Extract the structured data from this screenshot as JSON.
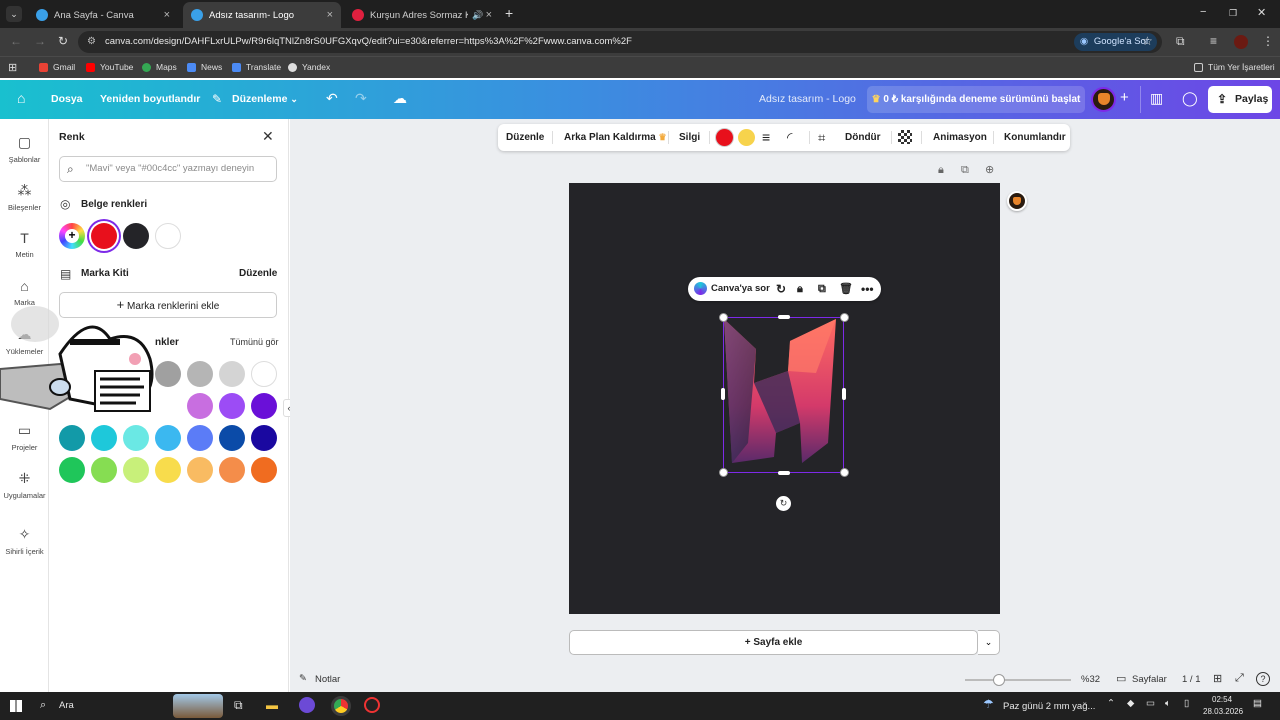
{
  "browser": {
    "tabs": [
      {
        "title": "Ana Sayfa - Canva",
        "favicon_color": "#3aa0e8"
      },
      {
        "title": "Adsız tasarım- Logo",
        "favicon_color": "#3aa0e8"
      },
      {
        "title": "Kurşun Adres Sormaz Ki | Yı",
        "favicon_color": "#e0203f"
      }
    ],
    "new_tab_icon": "plus-icon",
    "url": "canva.com/design/DAHFLxrULPw/R9r6lqTNlZn8rS0UFGXqvQ/edit?ui=e30&referrer=https%3A%2F%2Fwww.canva.com%2F",
    "google_ask": "Google'a Sor",
    "bookmarks": [
      "Gmail",
      "YouTube",
      "Maps",
      "News",
      "Translate",
      "Yandex"
    ],
    "all_bookmarks": "Tüm Yer İşaretleri"
  },
  "header": {
    "file": "Dosya",
    "resize": "Yeniden boyutlandır",
    "edit": "Düzenleme",
    "doc_title": "Adsız tasarım - Logo",
    "trial": "0 ₺ karşılığında deneme sürümünü başlat",
    "share": "Paylaş",
    "brand_color": "#7d2ae8"
  },
  "rail": [
    {
      "label": "Şablonlar",
      "icon": "templates-icon"
    },
    {
      "label": "Bileşenler",
      "icon": "elements-icon"
    },
    {
      "label": "Metin",
      "icon": "text-icon"
    },
    {
      "label": "Marka",
      "icon": "brand-icon"
    },
    {
      "label": "Yüklemeler",
      "icon": "uploads-icon"
    },
    {
      "label": "Projeler",
      "icon": "folder-icon"
    },
    {
      "label": "Uygulamalar",
      "icon": "apps-icon"
    },
    {
      "label": "Sihirli İçerik",
      "icon": "magic-icon"
    }
  ],
  "panel": {
    "title": "Renk",
    "search_placeholder": "\"Mavi\" veya \"#00c4cc\" yazmayı deneyin",
    "doc_colors_title": "Belge renkleri",
    "doc_colors": [
      "#e8101c",
      "#242428",
      "#ffffff"
    ],
    "brand_kit": "Marka Kiti",
    "brand_edit": "Düzenle",
    "add_brand_colors": "Marka renklerini ekle",
    "default_colors_title": "nkler",
    "see_all": "Tümünü gör",
    "palette_rows": [
      [
        "#a0a0a0",
        "#b5b5b5",
        "#d4d4d4",
        "#ffffff"
      ],
      [
        "#c86ee0",
        "#9c4cf5",
        "#6a10d8"
      ],
      [
        "#129aa8",
        "#1ec8da",
        "#6ae8e4",
        "#3bb8f0",
        "#5b7cf7",
        "#0b4ba8",
        "#1a08a0"
      ],
      [
        "#1fc65a",
        "#86dd52",
        "#c8f07a",
        "#f8dc4c",
        "#f9bb62",
        "#f48d4a",
        "#f06c20"
      ]
    ]
  },
  "context_toolbar": {
    "items": [
      "Düzenle",
      "Arka Plan Kaldırma",
      "Silgi",
      "Döndür",
      "Animasyon",
      "Konumlandır"
    ],
    "colors": [
      "#e8101c",
      "#f7d34c"
    ]
  },
  "mini_toolbar": {
    "ask": "Canva'ya sor"
  },
  "canvas": {
    "bg": "#242428",
    "add_page": "+ Sayfa ekle"
  },
  "bottom": {
    "notes": "Notlar",
    "zoom": "%32",
    "zoom_level": 0.32,
    "pages": "Sayfalar",
    "page_count": "1 / 1"
  },
  "taskbar": {
    "search": "Ara",
    "weather": "Paz günü 2 mm yağ...",
    "time": "02:54",
    "date": "28.03.2026"
  }
}
